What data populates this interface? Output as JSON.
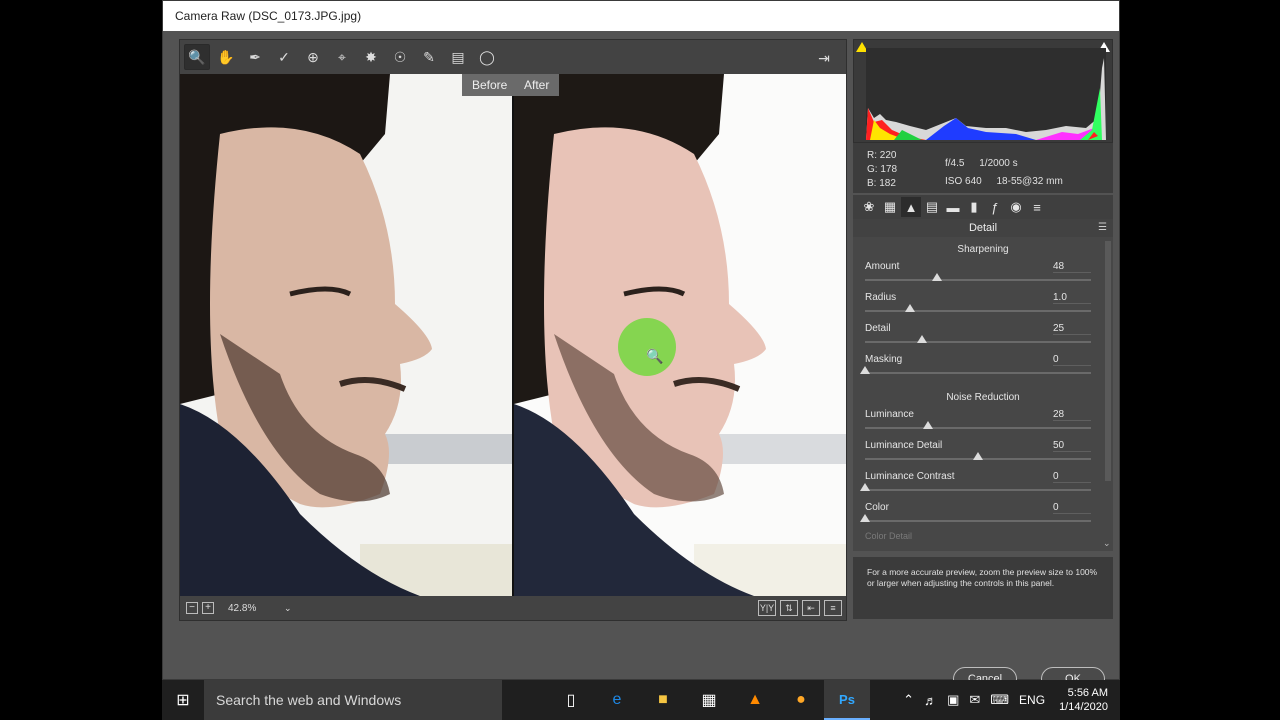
{
  "window": {
    "title": "Camera Raw (DSC_0173.JPG.jpg)"
  },
  "toolbar": {
    "tools": [
      "zoom-icon",
      "hand-icon",
      "white-balance-icon",
      "color-sampler-icon",
      "targeted-adjustment-icon",
      "crop-icon",
      "spot-removal-icon",
      "red-eye-icon",
      "adjustment-brush-icon",
      "graduated-filter-icon",
      "radial-filter-icon",
      "open-preferences-icon"
    ]
  },
  "preview": {
    "before_label": "Before",
    "after_label": "After",
    "zoom_level": "42.8%"
  },
  "info": {
    "r": "R:  220",
    "g": "G:  178",
    "b": "B:  182",
    "aperture": "f/4.5",
    "shutter": "1/2000 s",
    "iso": "ISO 640",
    "lens": "18-55@32 mm"
  },
  "panel": {
    "title": "Detail",
    "sharpening_title": "Sharpening",
    "noise_title": "Noise Reduction",
    "sharpening": [
      {
        "label": "Amount",
        "value": "48",
        "fraction": 0.32
      },
      {
        "label": "Radius",
        "value": "1.0",
        "fraction": 0.2
      },
      {
        "label": "Detail",
        "value": "25",
        "fraction": 0.25
      },
      {
        "label": "Masking",
        "value": "0",
        "fraction": 0.0
      }
    ],
    "noise": [
      {
        "label": "Luminance",
        "value": "28",
        "fraction": 0.28
      },
      {
        "label": "Luminance Detail",
        "value": "50",
        "fraction": 0.5
      },
      {
        "label": "Luminance Contrast",
        "value": "0",
        "fraction": 0.0
      },
      {
        "label": "Color",
        "value": "0",
        "fraction": 0.0
      }
    ],
    "next_label": "Color Detail",
    "tip": "For a more accurate preview, zoom the preview size to 100% or larger when adjusting the controls in this panel."
  },
  "buttons": {
    "cancel": "Cancel",
    "ok": "OK"
  },
  "taskbar": {
    "search_placeholder": "Search the web and Windows",
    "ps_label": "Ps",
    "lang": "ENG",
    "time": "5:56 AM",
    "date": "1/14/2020"
  },
  "colors": {
    "marker": "#7fd64a",
    "panel_bg": "#535353"
  }
}
